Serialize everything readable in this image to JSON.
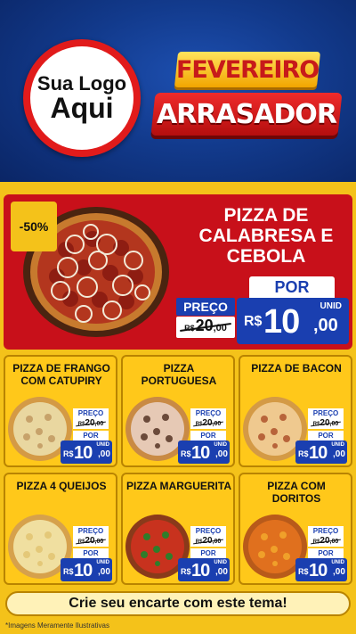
{
  "header": {
    "logo_line1": "Sua Logo",
    "logo_line2": "Aqui",
    "title_line1": "FEVEREIRO",
    "title_line2": "ARRASADOR"
  },
  "hero": {
    "discount": "-50%",
    "name": "PIZZA DE CALABRESA E CEBOLA",
    "preco_label": "PREÇO",
    "old_currency": "R$",
    "old_amount": "20",
    "old_cents": ",00",
    "por_label": "POR",
    "unid_label": "UNID",
    "new_currency": "R$",
    "new_amount": "10",
    "new_cents": ",00"
  },
  "cards": [
    {
      "name": "PIZZA DE FRANGO COM CATUPIRY",
      "preco_label": "PREÇO",
      "old_currency": "R$",
      "old_amount": "20",
      "old_cents": ",00",
      "por_label": "POR",
      "unid_label": "UNID",
      "new_currency": "R$",
      "new_amount": "10",
      "new_cents": ",00"
    },
    {
      "name": "PIZZA PORTUGUESA",
      "preco_label": "PREÇO",
      "old_currency": "R$",
      "old_amount": "20",
      "old_cents": ",00",
      "por_label": "POR",
      "unid_label": "UNID",
      "new_currency": "R$",
      "new_amount": "10",
      "new_cents": ",00"
    },
    {
      "name": "PIZZA DE BACON",
      "preco_label": "PREÇO",
      "old_currency": "R$",
      "old_amount": "20",
      "old_cents": ",00",
      "por_label": "POR",
      "unid_label": "UNID",
      "new_currency": "R$",
      "new_amount": "10",
      "new_cents": ",00"
    },
    {
      "name": "PIZZA 4 QUEIJOS",
      "preco_label": "PREÇO",
      "old_currency": "R$",
      "old_amount": "20",
      "old_cents": ",00",
      "por_label": "POR",
      "unid_label": "UNID",
      "new_currency": "R$",
      "new_amount": "10",
      "new_cents": ",00"
    },
    {
      "name": "PIZZA MARGUERITA",
      "preco_label": "PREÇO",
      "old_currency": "R$",
      "old_amount": "20",
      "old_cents": ",00",
      "por_label": "POR",
      "unid_label": "UNID",
      "new_currency": "R$",
      "new_amount": "10",
      "new_cents": ",00"
    },
    {
      "name": "PIZZA COM DORITOS",
      "preco_label": "PREÇO",
      "old_currency": "R$",
      "old_amount": "20",
      "old_cents": ",00",
      "por_label": "POR",
      "unid_label": "UNID",
      "new_currency": "R$",
      "new_amount": "10",
      "new_cents": ",00"
    }
  ],
  "cta": "Crie seu encarte com este tema!",
  "disclaimer": "*Imagens Meramente Ilustrativas",
  "colors": {
    "header_blue": "#123a8c",
    "brand_yellow": "#f4c21a",
    "hero_red": "#c8101a",
    "price_blue": "#1a3fb0"
  },
  "icons": {
    "hero_pizza": "calabresa-onion-pizza-image",
    "card_pizzas": [
      "chicken-catupiry-pizza-image",
      "portuguesa-pizza-image",
      "bacon-pizza-image",
      "four-cheese-pizza-image",
      "margherita-pizza-image",
      "doritos-pizza-image"
    ]
  }
}
